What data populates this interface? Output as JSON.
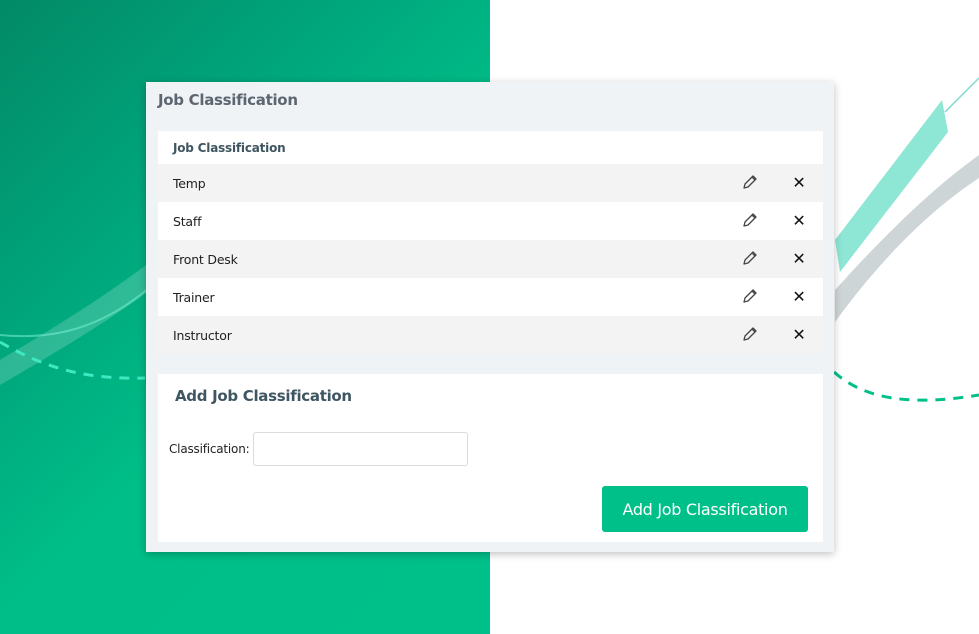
{
  "panel": {
    "title": "Job Classification"
  },
  "table": {
    "header": "Job Classification",
    "rows": [
      {
        "name": "Temp",
        "edit_icon": "pencil-icon",
        "delete_icon": "close-icon"
      },
      {
        "name": "Staff",
        "edit_icon": "pencil-icon",
        "delete_icon": "close-icon"
      },
      {
        "name": "Front Desk",
        "edit_icon": "pencil-icon",
        "delete_icon": "close-icon"
      },
      {
        "name": "Trainer",
        "edit_icon": "pencil-icon",
        "delete_icon": "close-icon"
      },
      {
        "name": "Instructor",
        "edit_icon": "pencil-icon",
        "delete_icon": "close-icon"
      }
    ],
    "delete_glyph": "✕"
  },
  "add_form": {
    "title": "Add Job Classification",
    "classification_label": "Classification:",
    "classification_value": "",
    "classification_placeholder": "",
    "submit_label": "Add Job Classification"
  },
  "colors": {
    "brand_green": "#00c08a",
    "dark_green": "#028a66",
    "heading_text": "#3f5561",
    "panel_bg": "#eff3f6"
  }
}
